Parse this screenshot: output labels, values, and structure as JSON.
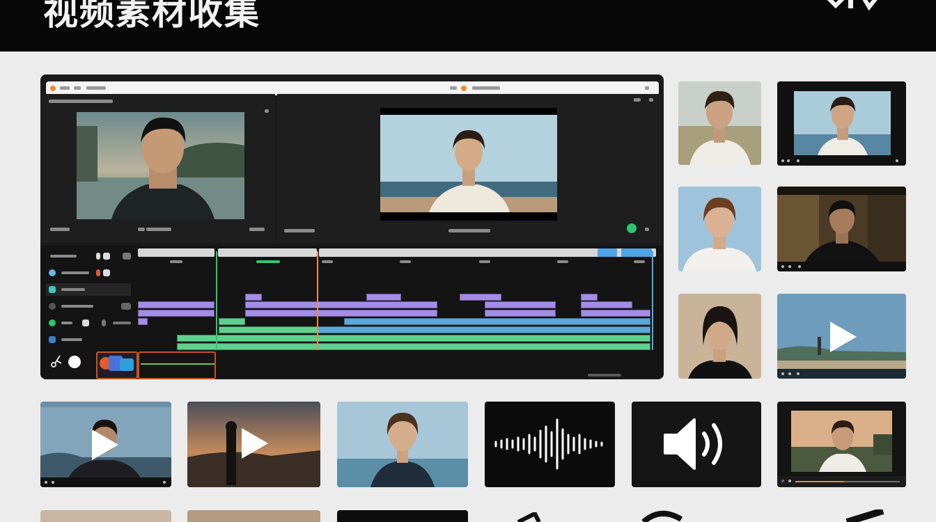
{
  "banner": {
    "title": "视频素材收集"
  },
  "colors": {
    "banner": "#070707",
    "panel": "#1a1a1a",
    "timeline_purple": "#a48de8",
    "timeline_blue": "#5aa9d8",
    "timeline_green": "#5fd08e",
    "playhead": "#ff8a3d"
  },
  "icons": [
    "play-icon",
    "waveform-icon",
    "speaker-icon",
    "gear-icon",
    "scissors-icon"
  ]
}
